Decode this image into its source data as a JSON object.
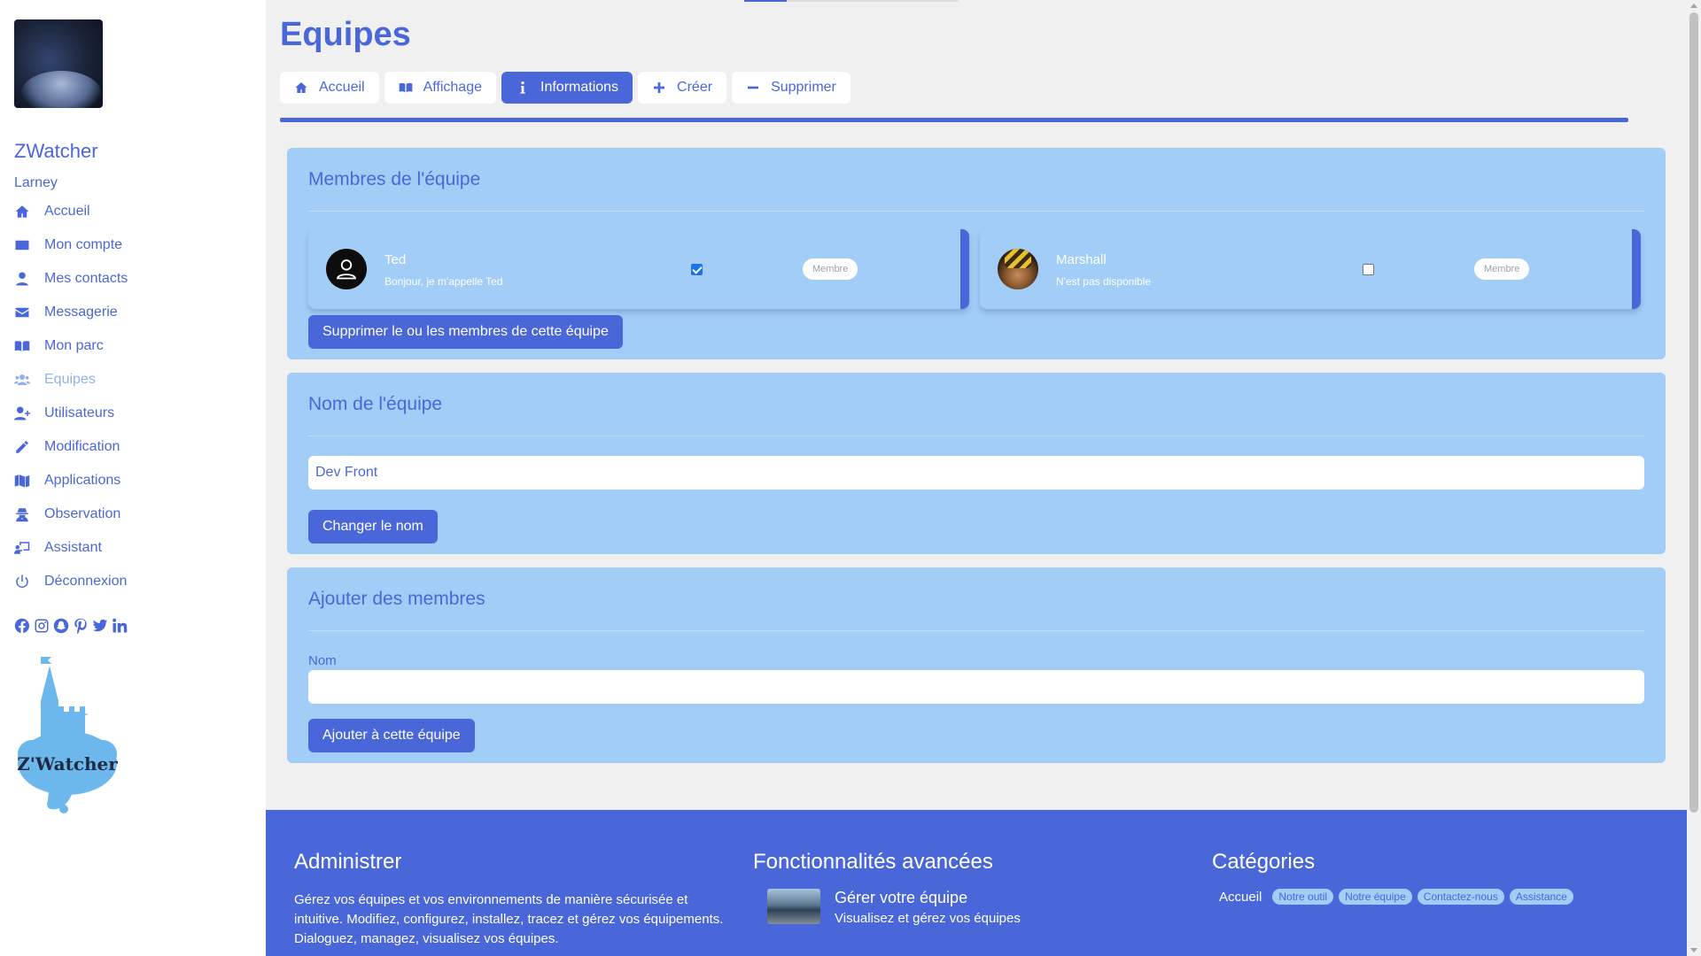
{
  "sidebar": {
    "brand": "ZWatcher",
    "username": "Larney",
    "items": [
      {
        "label": "Accueil",
        "icon": "home-icon"
      },
      {
        "label": "Mon compte",
        "icon": "id-card-icon"
      },
      {
        "label": "Mes contacts",
        "icon": "user-icon"
      },
      {
        "label": "Messagerie",
        "icon": "envelope-icon"
      },
      {
        "label": "Mon parc",
        "icon": "book-open-icon"
      },
      {
        "label": "Equipes",
        "icon": "users-icon",
        "active": true
      },
      {
        "label": "Utilisateurs",
        "icon": "user-plus-icon"
      },
      {
        "label": "Modification",
        "icon": "pencil-icon"
      },
      {
        "label": "Applications",
        "icon": "map-icon"
      },
      {
        "label": "Observation",
        "icon": "user-secret-icon"
      },
      {
        "label": "Assistant",
        "icon": "chalkboard-teacher-icon"
      },
      {
        "label": "Déconnexion",
        "icon": "power-icon"
      }
    ],
    "socials": [
      "facebook-icon",
      "instagram-icon",
      "snapchat-icon",
      "pinterest-icon",
      "twitter-icon",
      "linkedin-icon"
    ],
    "logo_text": "Z'Watcher"
  },
  "page": {
    "title": "Equipes",
    "tabs": [
      {
        "label": "Accueil",
        "icon": "home-icon"
      },
      {
        "label": "Affichage",
        "icon": "book-open-icon"
      },
      {
        "label": "Informations",
        "icon": "info-icon",
        "active": true
      },
      {
        "label": "Créer",
        "icon": "plus-icon"
      },
      {
        "label": "Supprimer",
        "icon": "minus-icon"
      }
    ]
  },
  "members_section": {
    "title": "Membres de l'équipe",
    "members": [
      {
        "name": "Ted",
        "status": "Bonjour, je m'appelle Ted",
        "role": "Membre",
        "checked": true
      },
      {
        "name": "Marshall",
        "status": "N'est pas disponible",
        "role": "Membre",
        "checked": false
      }
    ],
    "delete_button": "Supprimer le ou les membres de cette équipe"
  },
  "name_section": {
    "title": "Nom de l'équipe",
    "value": "Dev Front",
    "button": "Changer le nom"
  },
  "add_section": {
    "title": "Ajouter des membres",
    "label": "Nom",
    "value": "",
    "button": "Ajouter à cette équipe"
  },
  "footer": {
    "col1": {
      "title": "Administrer",
      "text": "Gérez vos équipes et vos environnements de manière sécurisée et intuitive. Modifiez, configurez, installez, tracez et gérez vos équipements. Dialoguez, managez, visualisez vos équipes."
    },
    "col2": {
      "title": "Fonctionnalités avancées",
      "item_title": "Gérer votre équipe",
      "item_subtitle": "Visualisez et gérez vos équipes"
    },
    "col3": {
      "title": "Catégories",
      "home": "Accueil",
      "tags": [
        "Notre outil",
        "Notre équipe",
        "Contactez-nous",
        "Assistance"
      ]
    }
  },
  "colors": {
    "primary": "#4a67d9",
    "card": "#a2cdf6",
    "background": "#f0f0f0",
    "nav_active": "#8fb2ee"
  }
}
